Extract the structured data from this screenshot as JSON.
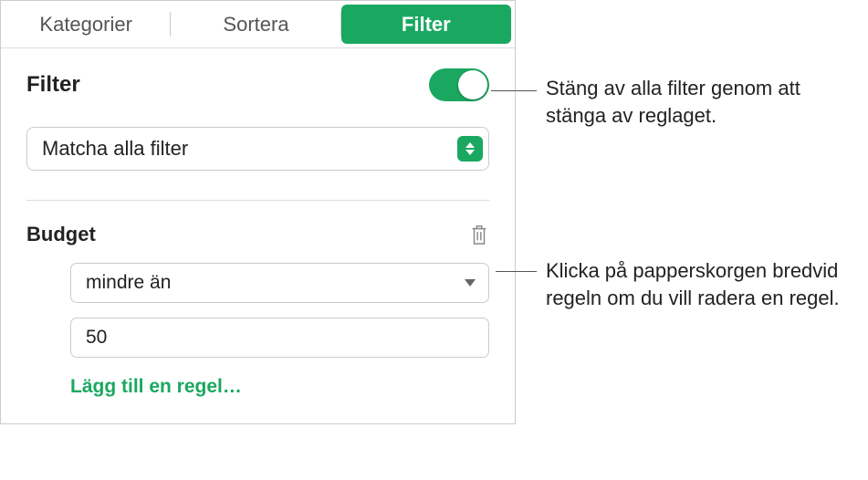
{
  "tabs": {
    "categories": "Kategorier",
    "sort": "Sortera",
    "filter": "Filter"
  },
  "filter": {
    "title": "Filter",
    "match_mode": "Matcha alla filter"
  },
  "rule": {
    "name": "Budget",
    "condition": "mindre än",
    "value": "50",
    "add_label": "Lägg till en regel…"
  },
  "annotations": {
    "toggle": "Stäng av alla filter genom att stänga av reglaget.",
    "trash": "Klicka på papperskorgen bredvid regeln om du vill radera en regel."
  }
}
